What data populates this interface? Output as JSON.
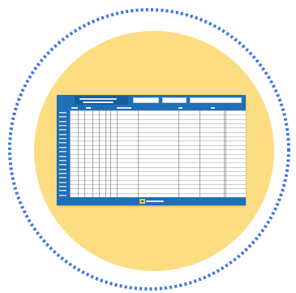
{
  "illustration": {
    "icon": "spreadsheet-thumbnail-icon",
    "colors": {
      "ring": "#3d74e8",
      "circle": "#fcdd82",
      "header": "#1e6fb7",
      "paper": "#ffffff",
      "grid": "#7a7a7a"
    }
  }
}
